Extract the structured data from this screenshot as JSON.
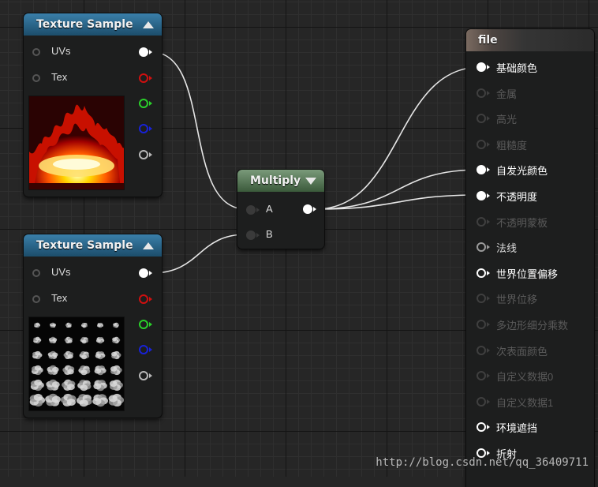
{
  "texture_node_1": {
    "title": "Texture Sample",
    "input_pins": [
      "UVs",
      "Tex"
    ],
    "preview_icon": "fire-texture"
  },
  "texture_node_2": {
    "title": "Texture Sample",
    "input_pins": [
      "UVs",
      "Tex"
    ],
    "preview_icon": "flipbook-fire-texture"
  },
  "multiply_node": {
    "title": "Multiply",
    "inputs": [
      "A",
      "B"
    ]
  },
  "material_node": {
    "title": "file",
    "pins": [
      {
        "label": "基础颜色",
        "state": "connected"
      },
      {
        "label": "金属",
        "state": "disabled"
      },
      {
        "label": "高光",
        "state": "disabled"
      },
      {
        "label": "粗糙度",
        "state": "disabled"
      },
      {
        "label": "自发光颜色",
        "state": "connected"
      },
      {
        "label": "不透明度",
        "state": "connected"
      },
      {
        "label": "不透明蒙板",
        "state": "disabled"
      },
      {
        "label": "法线",
        "state": "enabled"
      },
      {
        "label": "世界位置偏移",
        "state": "enabled-bright"
      },
      {
        "label": "世界位移",
        "state": "disabled"
      },
      {
        "label": "多边形细分乘数",
        "state": "disabled"
      },
      {
        "label": "次表面颜色",
        "state": "disabled"
      },
      {
        "label": "自定义数据0",
        "state": "disabled"
      },
      {
        "label": "自定义数据1",
        "state": "disabled"
      },
      {
        "label": "环境遮挡",
        "state": "enabled-bright"
      },
      {
        "label": "折射",
        "state": "enabled-bright"
      }
    ]
  },
  "watermark": "http://blog.csdn.net/qq_36409711",
  "colors": {
    "texture_header": "#2a6a90",
    "multiply_header": "#5a7a5a",
    "pin_red": "#d01010",
    "pin_green": "#2ad02a",
    "pin_blue": "#1822d8",
    "wire": "#e0e0e0"
  }
}
